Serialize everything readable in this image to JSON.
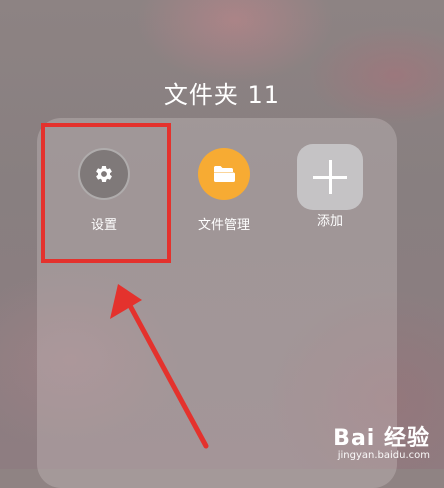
{
  "folder": {
    "title": "文件夹 11"
  },
  "apps": {
    "settings": {
      "label": "设置",
      "icon": "gear-icon"
    },
    "file_manager": {
      "label": "文件管理",
      "icon": "folder-icon"
    },
    "add": {
      "label": "添加",
      "icon": "plus-icon"
    }
  },
  "annotation": {
    "highlight_color": "#e4322d",
    "arrow_color": "#e4322d"
  },
  "watermark": {
    "main": "Bai 经验",
    "sub": "jingyan.baidu.com"
  }
}
